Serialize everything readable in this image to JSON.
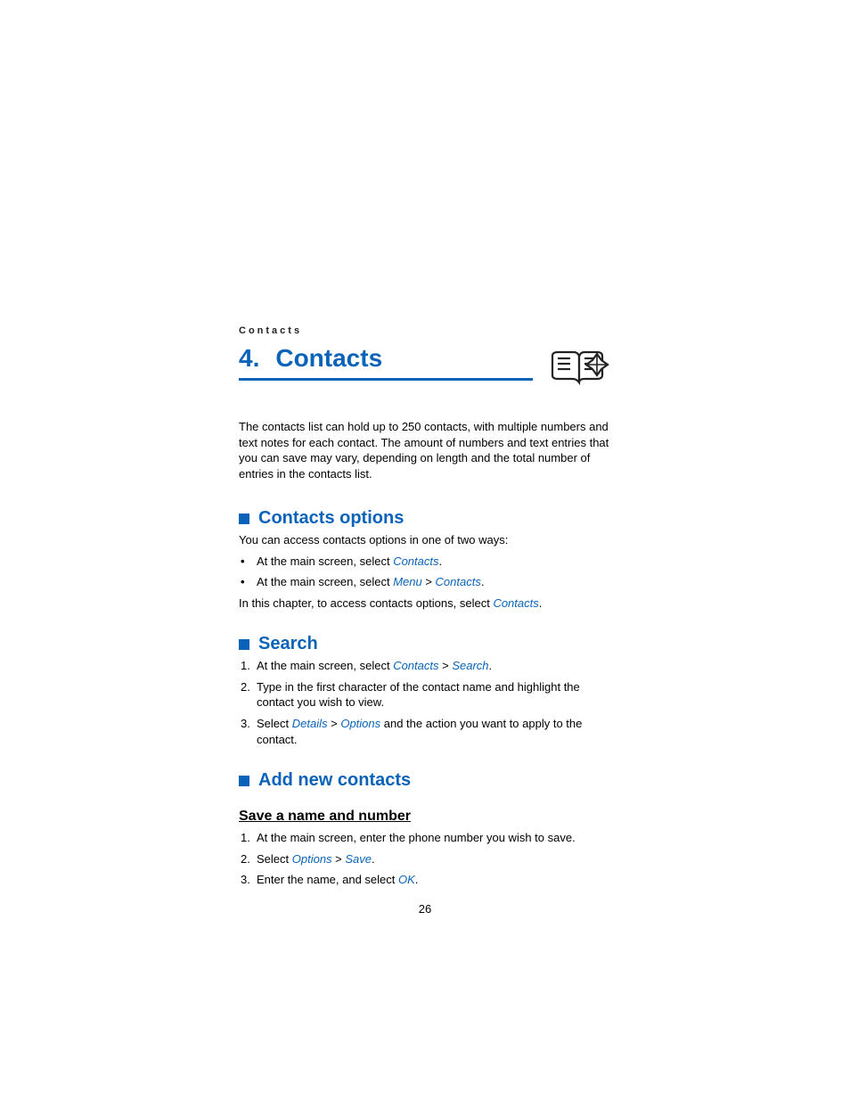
{
  "running_head": "Contacts",
  "chapter": {
    "num": "4.",
    "title": "Contacts"
  },
  "intro": "The contacts list can hold up to 250 contacts, with multiple numbers and text notes for each contact. The amount of numbers and text entries that you can save may vary, depending on length and the total number of entries in the contacts list.",
  "sections": {
    "options": {
      "title": "Contacts options",
      "lead": "You can access contacts options in one of two ways:",
      "bullets": {
        "b1": {
          "pre": "At the main screen, select ",
          "term": "Contacts",
          "post": "."
        },
        "b2": {
          "pre": "At the main screen, select ",
          "t1": "Menu",
          "sep": " > ",
          "t2": "Contacts",
          "post": "."
        }
      },
      "tail": {
        "pre": "In this chapter, to access contacts options, select ",
        "term": "Contacts",
        "post": "."
      }
    },
    "search": {
      "title": "Search",
      "steps": {
        "s1": {
          "n": "1.",
          "pre": "At the main screen, select ",
          "t1": "Contacts",
          "sep": " > ",
          "t2": "Search",
          "post": "."
        },
        "s2": {
          "n": "2.",
          "text": "Type in the first character of the contact name and highlight the contact you wish to view."
        },
        "s3": {
          "n": "3.",
          "pre": "Select ",
          "t1": "Details",
          "sep": " > ",
          "t2": "Options",
          "post": " and the action you want to apply to the contact."
        }
      }
    },
    "add": {
      "title": "Add new contacts",
      "sub": {
        "title": "Save a name and number",
        "steps": {
          "s1": {
            "n": "1.",
            "text": "At the main screen, enter the phone number you wish to save."
          },
          "s2": {
            "n": "2.",
            "pre": "Select ",
            "t1": "Options",
            "sep": " > ",
            "t2": "Save",
            "post": "."
          },
          "s3": {
            "n": "3.",
            "pre": "Enter the name, and select ",
            "t1": "OK",
            "post": "."
          }
        }
      }
    }
  },
  "page_number": "26"
}
